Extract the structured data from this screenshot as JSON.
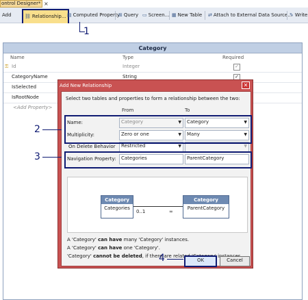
{
  "window": {
    "tab_title": "ontrol Designer*",
    "close_glyph": "×"
  },
  "toolbar": {
    "add_label": "Add",
    "relationship_label": "Relationship...",
    "computed_property_label": "Computed Property",
    "query_label": "Query",
    "screen_label": "Screen...",
    "new_table_label": "New Table",
    "attach_label": "Attach to External Data Source...",
    "write_label": "Write"
  },
  "entity": {
    "title": "Category",
    "col_name": "Name",
    "col_type": "Type",
    "col_required": "Required",
    "rows": [
      {
        "name": "Id",
        "type": "Integer"
      },
      {
        "name": "CategoryName",
        "type": "String"
      },
      {
        "name": "IsSelected",
        "type": ""
      },
      {
        "name": "IsRootNode",
        "type": ""
      }
    ],
    "add_property": "<Add Property>"
  },
  "dialog": {
    "title": "Add New Relationship",
    "instruction": "Select two tables and properties to form a relationship between the two:",
    "from_header": "From",
    "to_header": "To",
    "name_label": "Name:",
    "name_from": "Category",
    "name_to": "Category",
    "multiplicity_label": "Multiplicity:",
    "mult_from": "Zero or one",
    "mult_to": "Many",
    "ondelete_label": "On Delete Behavior",
    "ondelete_from": "Restricted",
    "navprop_label": "Navigation Property:",
    "navprop_from": "Categories",
    "navprop_to": "ParentCategory",
    "diagram": {
      "left_title": "Category",
      "left_prop": "Categories",
      "right_title": "Category",
      "right_prop": "ParentCategory",
      "left_mult": "0..1",
      "right_mult": "∞"
    },
    "msg1_pre": "A 'Category'",
    "msg1_bold": "can have",
    "msg1_post": "many 'Category' instances.",
    "msg2_pre": "A 'Category'",
    "msg2_bold": "can have",
    "msg2_post": "one 'Category'.",
    "msg3_pre": "'Category'",
    "msg3_bold": "cannot be deleted",
    "msg3_post": ", if there are related 'Category' instances.",
    "ok_label": "OK",
    "cancel_label": "Cancel"
  },
  "callouts": {
    "c1": "1",
    "c2": "2",
    "c3": "3",
    "c4": "4"
  },
  "colors": {
    "highlight": "#0e1a72",
    "dialog_frame": "#c95252",
    "entity_header": "#c0cfe4"
  }
}
